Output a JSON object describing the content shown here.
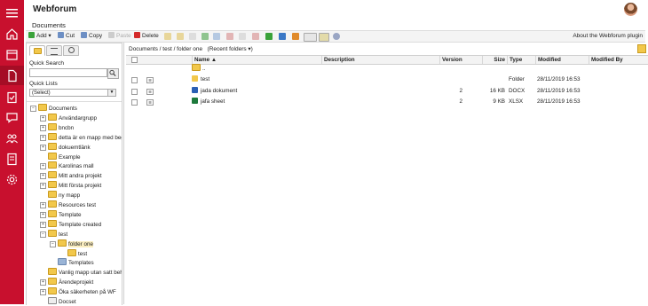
{
  "app": {
    "title": "Webforum",
    "page_title": "Documents"
  },
  "rail": {
    "icons": [
      "menu-icon",
      "home-icon",
      "calendar-icon",
      "documents-icon",
      "tasks-icon",
      "chat-icon",
      "people-icon",
      "form-icon",
      "settings-icon"
    ],
    "active": "documents-icon"
  },
  "toolbar": {
    "add": "Add",
    "cut": "Cut",
    "copy": "Copy",
    "paste": "Paste",
    "delete": "Delete",
    "about": "About the Webforum plugin"
  },
  "left": {
    "quick_search_label": "Quick Search",
    "quick_search_value": "",
    "quick_lists_label": "Quick Lists",
    "quick_lists_selected": "(Select)",
    "tree": [
      {
        "label": "Documents",
        "exp": "−"
      },
      {
        "label": "Användargrupp",
        "exp": "+"
      },
      {
        "label": "bncbn",
        "exp": "+"
      },
      {
        "label": "detta är en mapp med begrän",
        "exp": "+"
      },
      {
        "label": "dokuemtlänk",
        "exp": "+"
      },
      {
        "label": "Example",
        "exp": ""
      },
      {
        "label": "Karolinas mall",
        "exp": "+"
      },
      {
        "label": "Mitt andra projekt",
        "exp": "+"
      },
      {
        "label": "Mitt första projekt",
        "exp": "+"
      },
      {
        "label": "ny mapp",
        "exp": ""
      },
      {
        "label": "Resources test",
        "exp": "+"
      },
      {
        "label": "Template",
        "exp": "+"
      },
      {
        "label": "Template created",
        "exp": "+"
      },
      {
        "label": "test",
        "exp": "−"
      },
      {
        "label": "folder one",
        "exp": "−"
      },
      {
        "label": "test",
        "exp": ""
      },
      {
        "label": "Templates",
        "exp": ""
      },
      {
        "label": "Vanlig mapp utan satt behöri",
        "exp": ""
      },
      {
        "label": "Ärendeprojekt",
        "exp": "+"
      },
      {
        "label": "Öka säkerheten på WF",
        "exp": "+"
      },
      {
        "label": "Docset",
        "exp": ""
      }
    ]
  },
  "main": {
    "breadcrumb": "Documents / test / folder one",
    "recent": "(Recent folders ▾)",
    "columns": {
      "name": "Name ▲",
      "description": "Description",
      "version": "Version",
      "size": "Size",
      "type": "Type",
      "modified": "Modified",
      "modified_by": "Modified By"
    },
    "up_label": "..",
    "rows": [
      {
        "name": "test",
        "description": "",
        "version": "",
        "size": "",
        "type": "Folder",
        "modified": "28/11/2019 16:53",
        "modified_by": "",
        "icon": "folder-icon"
      },
      {
        "name": "jada dokument",
        "description": "",
        "version": "2",
        "size": "16 KB",
        "type": "DOCX",
        "modified": "28/11/2019 16:53",
        "modified_by": "",
        "icon": "word-icon"
      },
      {
        "name": "jafa sheet",
        "description": "",
        "version": "2",
        "size": "9 KB",
        "type": "XLSX",
        "modified": "28/11/2019 16:53",
        "modified_by": "",
        "icon": "excel-icon"
      }
    ]
  },
  "colors": {
    "rail": "#c8102e",
    "selection": "#fbeec0"
  }
}
